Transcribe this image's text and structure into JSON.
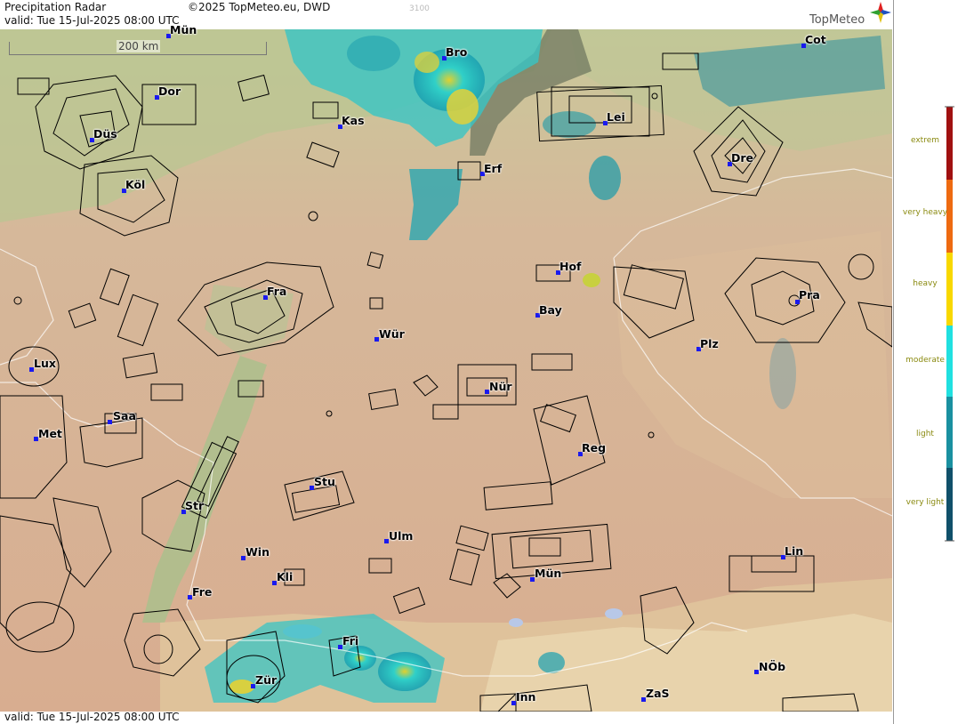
{
  "header": {
    "product": "Precipitation Radar",
    "copyright": "©2025 TopMeteo.eu, DWD",
    "valid": "valid:  Tue  15-Jul-2025 08:00 UTC",
    "code": "3100",
    "logo": "TopMeteo"
  },
  "footer": {
    "valid": "valid:  Tue  15-Jul-2025 08:00 UTC"
  },
  "scale": {
    "label": "200 km"
  },
  "legend": {
    "items": [
      {
        "label": "extrem",
        "color": "#a01010"
      },
      {
        "label": "very heavy",
        "color": "#ee6a10"
      },
      {
        "label": "heavy",
        "color": "#f8d800"
      },
      {
        "label": "moderate",
        "color": "#20e0e0"
      },
      {
        "label": "light",
        "color": "#1a90a0"
      },
      {
        "label": "very light",
        "color": "#10506a"
      }
    ]
  },
  "cities": [
    {
      "name": "Mün",
      "id": "munster"
    },
    {
      "name": "Bro",
      "id": "brocken"
    },
    {
      "name": "Cot",
      "id": "cottbus"
    },
    {
      "name": "Dor",
      "id": "dortmund"
    },
    {
      "name": "Kas",
      "id": "kassel"
    },
    {
      "name": "Lei",
      "id": "leipzig"
    },
    {
      "name": "Düs",
      "id": "dusseldorf"
    },
    {
      "name": "Dre",
      "id": "dresden"
    },
    {
      "name": "Erf",
      "id": "erfurt"
    },
    {
      "name": "Köl",
      "id": "koln"
    },
    {
      "name": "Hof",
      "id": "hof"
    },
    {
      "name": "Fra",
      "id": "frankfurt"
    },
    {
      "name": "Pra",
      "id": "prague"
    },
    {
      "name": "Bay",
      "id": "bayreuth"
    },
    {
      "name": "Wür",
      "id": "wurzburg"
    },
    {
      "name": "Plz",
      "id": "plzen"
    },
    {
      "name": "Lux",
      "id": "luxembourg"
    },
    {
      "name": "Nür",
      "id": "nurnberg"
    },
    {
      "name": "Saa",
      "id": "saarbrucken"
    },
    {
      "name": "Met",
      "id": "metz"
    },
    {
      "name": "Reg",
      "id": "regensburg"
    },
    {
      "name": "Stu",
      "id": "stuttgart"
    },
    {
      "name": "Str",
      "id": "strasbourg"
    },
    {
      "name": "Ulm",
      "id": "ulm"
    },
    {
      "name": "Win",
      "id": "win"
    },
    {
      "name": "Lin",
      "id": "linz"
    },
    {
      "name": "Mün",
      "id": "munchen"
    },
    {
      "name": "Kli",
      "id": "kli"
    },
    {
      "name": "Fre",
      "id": "freiburg"
    },
    {
      "name": "Fri",
      "id": "friedrichshafen"
    },
    {
      "name": "NÖb",
      "id": "nob"
    },
    {
      "name": "Zür",
      "id": "zurich"
    },
    {
      "name": "ZaS",
      "id": "zas"
    },
    {
      "name": "Inn",
      "id": "innsbruck"
    }
  ]
}
